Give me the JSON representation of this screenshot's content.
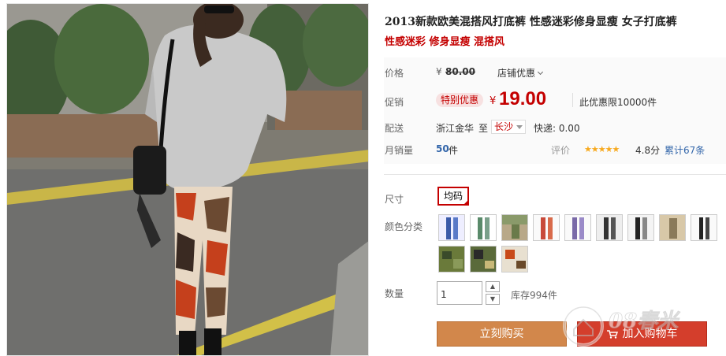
{
  "product": {
    "title": "2013新款欧美混搭风打底裤 性感迷彩修身显瘦 女子打底裤",
    "subtitle": "性感迷彩 修身显瘦 混搭风"
  },
  "price": {
    "label": "价格",
    "currency": "¥",
    "original": "80.00",
    "shop_discount": "店铺优惠"
  },
  "promo": {
    "label": "促销",
    "tag": "特别优惠",
    "currency": "¥",
    "price": "19.00",
    "limit": "此优惠限10000件"
  },
  "shipping": {
    "label": "配送",
    "origin": "浙江金华",
    "to": "至",
    "destination": "长沙",
    "fee": "快递: 0.00"
  },
  "sales": {
    "label": "月销量",
    "count": "50",
    "unit": "件",
    "rating_label": "评价",
    "stars": "★★★★★",
    "score": "4.8分",
    "reviews": "累计67条"
  },
  "size": {
    "label": "尺寸",
    "selected": "均码"
  },
  "color": {
    "label": "颜色分类",
    "swatches": [
      "blue-camo",
      "white-pattern",
      "green-camo-photo",
      "floral",
      "purple-pattern",
      "black-print",
      "black-white",
      "beige-photo",
      "black-thin",
      "grey-camo",
      "green-camo",
      "brown-camo",
      "orange-camo"
    ]
  },
  "quantity": {
    "label": "数量",
    "value": "1",
    "stock": "库存994件"
  },
  "actions": {
    "buy_now": "立刻购买",
    "add_to_cart": "加入购物车"
  },
  "watermark": {
    "text": "08春米"
  },
  "colors": {
    "accent_red": "#c40000",
    "buy_button": "#d2874b",
    "cart_button": "#d43e2c",
    "link_blue": "#3366aa"
  }
}
